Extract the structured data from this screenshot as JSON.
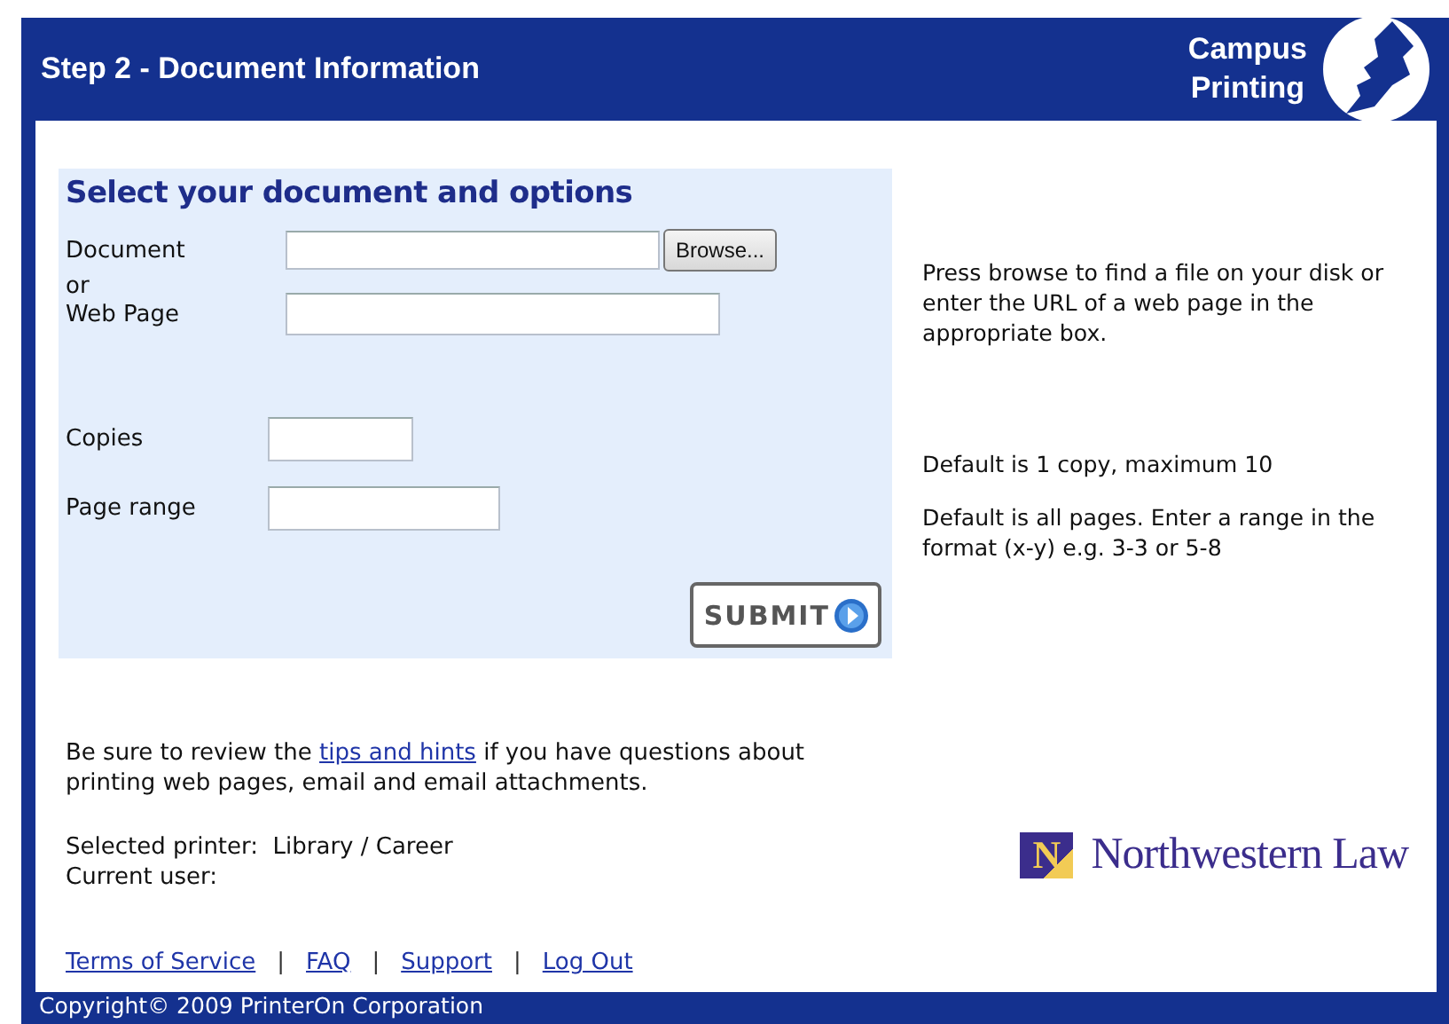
{
  "header": {
    "title": "Step 2 - Document Information",
    "brand": [
      "Campus",
      "Printing"
    ]
  },
  "form": {
    "heading": "Select your document and options",
    "document": {
      "label": "Document",
      "button": "Browse..."
    },
    "separator": "or",
    "web_page": {
      "label": "Web Page"
    },
    "copies": {
      "label": "Copies"
    },
    "page_range": {
      "label": "Page range"
    },
    "submit": "SUBMIT"
  },
  "help": [
    "Press browse to find a file on your disk or enter the URL of a web page in the appropriate box.",
    "Default is 1 copy, maximum 10",
    "Default is all pages. Enter a range in the format (x-y) e.g. 3-3 or 5-8"
  ],
  "notice": {
    "before": "Be sure to review the",
    "link": "tips and hints",
    "after": "if you have questions about printing web pages, email and email attachments."
  },
  "printer": {
    "label": "Selected printer:",
    "value": "Library / Career"
  },
  "user": {
    "label": "Current user:"
  },
  "links": [
    "Terms of Service",
    "FAQ",
    "Support",
    "Log Out"
  ],
  "link_separator": "|",
  "logo": {
    "mark": "N",
    "name": "Northwestern Law"
  },
  "copyright": "Copyright© 2009 PrinterOn Corporation"
}
